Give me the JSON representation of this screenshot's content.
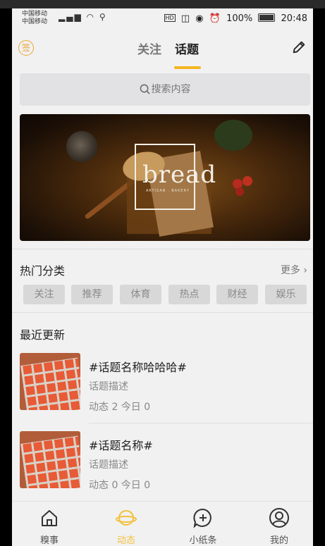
{
  "status_bar": {
    "carrier_line1": "中国移动",
    "carrier_line2": "中国移动",
    "network_tags": "4G 2G",
    "battery": "100%",
    "time": "20:48",
    "hd_label": "HD"
  },
  "header": {
    "sign_label": "签",
    "tabs": [
      {
        "label": "关注",
        "active": false
      },
      {
        "label": "话题",
        "active": true
      }
    ],
    "edit_icon": "pencil-icon"
  },
  "search": {
    "placeholder": "搜索内容",
    "icon": "search-icon"
  },
  "banner": {
    "word": "bread",
    "subline": "ARTISAN · BAKERY"
  },
  "hot_categories": {
    "title": "热门分类",
    "more_label": "更多",
    "chips": [
      "关注",
      "推荐",
      "体育",
      "热点",
      "财经",
      "娱乐"
    ]
  },
  "recent": {
    "title": "最近更新",
    "items": [
      {
        "title": "#话题名称哈哈哈#",
        "desc": "话题描述",
        "stats": "动态 2 今日 0"
      },
      {
        "title": "#话题名称#",
        "desc": "话题描述",
        "stats": "动态 0 今日 0"
      }
    ]
  },
  "bottom_nav": [
    {
      "label": "糗事",
      "icon": "home-icon",
      "active": false
    },
    {
      "label": "动态",
      "icon": "planet-icon",
      "active": true
    },
    {
      "label": "小纸条",
      "icon": "chat-plus-icon",
      "active": false
    },
    {
      "label": "我的",
      "icon": "profile-icon",
      "active": false
    }
  ],
  "colors": {
    "accent": "#f3b521",
    "active_nav": "#f2c13c",
    "background": "#f1f1f1"
  }
}
